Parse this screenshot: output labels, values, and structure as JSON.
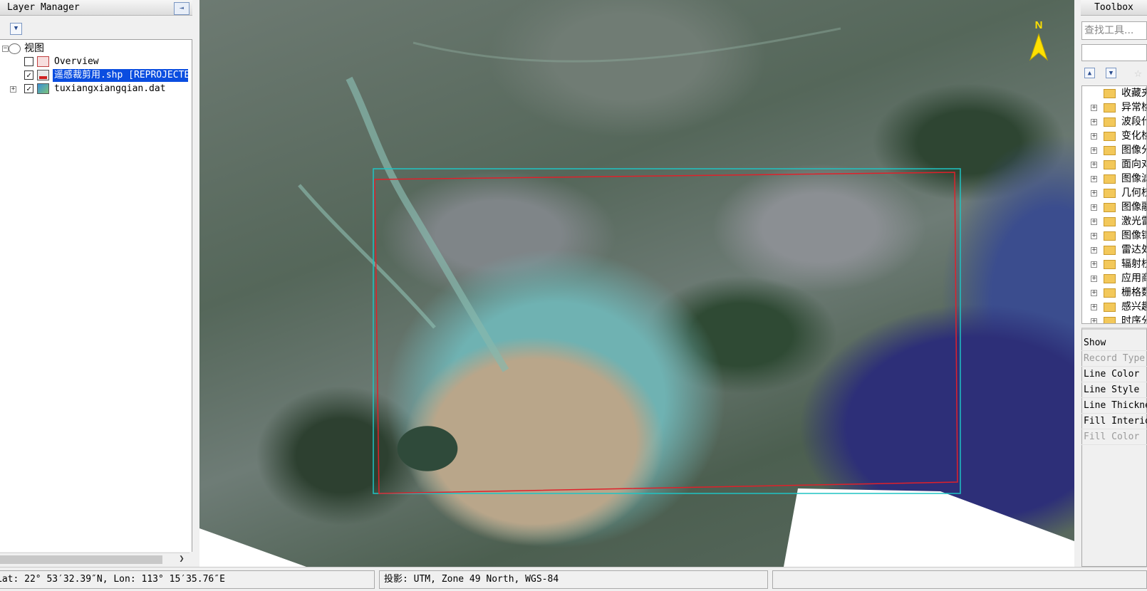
{
  "layer_manager": {
    "title": "Layer Manager",
    "pin_glyph": "⇥",
    "root_label": "视图",
    "layers": [
      {
        "label": "Overview",
        "checked": false
      },
      {
        "label": "遥感裁剪用.shp [REPROJECTED]",
        "checked": true,
        "selected": true
      },
      {
        "label": "tuxiangxiangqian.dat",
        "checked": true
      }
    ]
  },
  "map": {
    "north_label": "N",
    "colors": {
      "red_box": "#e0202a",
      "cyan_box": "#1fc4c4"
    }
  },
  "toolbox": {
    "title": "Toolbox",
    "search_placeholder": "查找工具...",
    "folders": [
      {
        "label": "收藏夹",
        "expandable": false
      },
      {
        "label": "异常检测",
        "expandable": true
      },
      {
        "label": "波段代数",
        "expandable": true
      },
      {
        "label": "变化检测",
        "expandable": true
      },
      {
        "label": "图像分类",
        "expandable": true
      },
      {
        "label": "面向对象",
        "expandable": true
      },
      {
        "label": "图像滤波",
        "expandable": true
      },
      {
        "label": "几何校正",
        "expandable": true
      },
      {
        "label": "图像融合",
        "expandable": true
      },
      {
        "label": "激光雷达",
        "expandable": true
      },
      {
        "label": "图像镶嵌",
        "expandable": true
      },
      {
        "label": "雷达处理",
        "expandable": true
      },
      {
        "label": "辐射校正",
        "expandable": true
      },
      {
        "label": "应用商店",
        "expandable": true
      },
      {
        "label": "栅格数据",
        "expandable": true
      },
      {
        "label": "感兴趣区",
        "expandable": true
      },
      {
        "label": "时序分析",
        "expandable": true
      }
    ],
    "properties": [
      {
        "label": "Show",
        "disabled": false
      },
      {
        "label": "Record Type",
        "disabled": true
      },
      {
        "label": "Line Color",
        "disabled": false
      },
      {
        "label": "Line Style",
        "disabled": false
      },
      {
        "label": "Line Thickness",
        "disabled": false
      },
      {
        "label": "Fill Interior",
        "disabled": false
      },
      {
        "label": "Fill Color",
        "disabled": true
      }
    ]
  },
  "status": {
    "coords": "Lat: 22° 53′32.39″N, Lon: 113° 15′35.76″E",
    "projection": "投影:  UTM, Zone 49 North, WGS-84",
    "extra": ""
  }
}
